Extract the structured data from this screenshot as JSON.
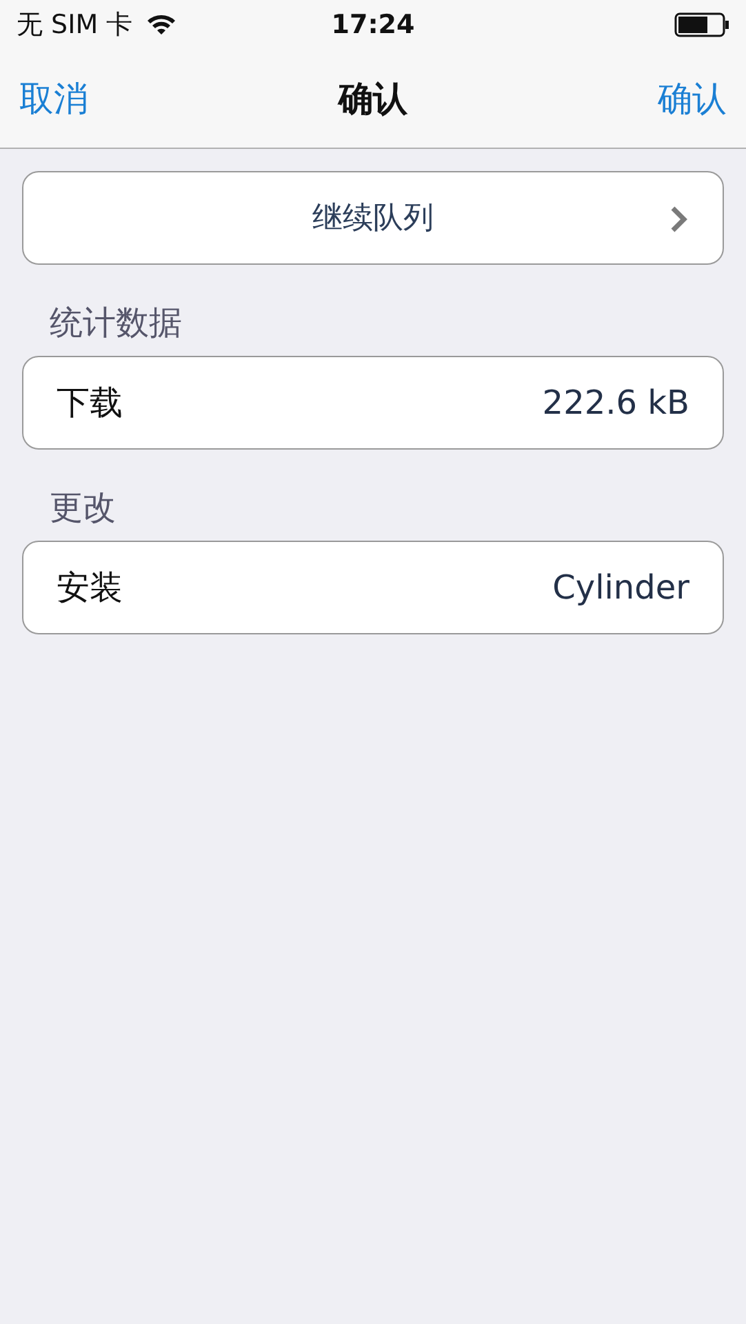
{
  "status_bar": {
    "carrier": "无 SIM 卡",
    "time": "17:24"
  },
  "nav_bar": {
    "left_button": "取消",
    "title": "确认",
    "right_button": "确认"
  },
  "action": {
    "label": "继续队列"
  },
  "sections": [
    {
      "header": "统计数据",
      "rows": [
        {
          "label": "下载",
          "value": "222.6 kB"
        }
      ]
    },
    {
      "header": "更改",
      "rows": [
        {
          "label": "安装",
          "value": "Cylinder"
        }
      ]
    }
  ]
}
